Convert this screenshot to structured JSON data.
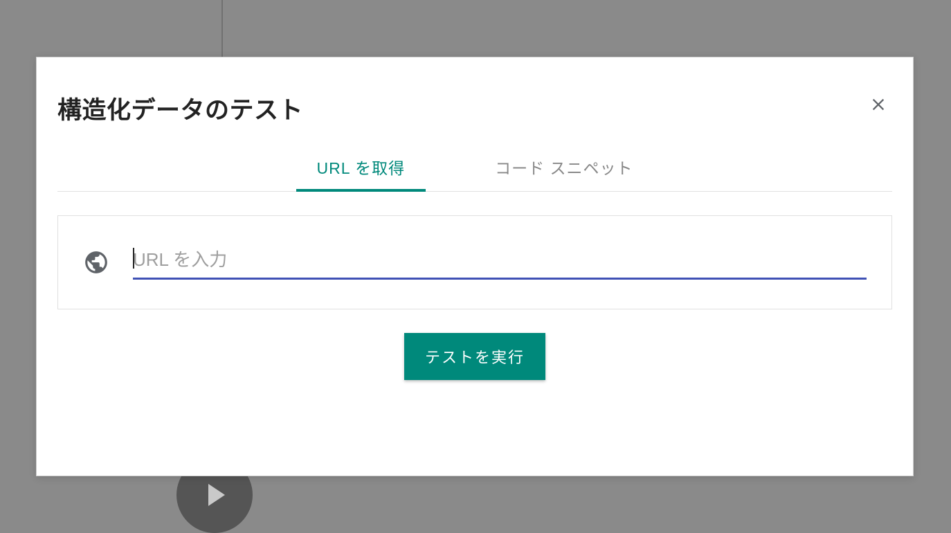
{
  "modal": {
    "title": "構造化データのテスト",
    "tabs": {
      "fetch_url": "URL を取得",
      "code_snippet": "コード スニペット"
    },
    "input": {
      "placeholder": "URL を入力",
      "value": ""
    },
    "submit_label": "テストを実行"
  },
  "colors": {
    "accent": "#00897b",
    "underline": "#3f51b5",
    "text_secondary": "#5f6368"
  }
}
